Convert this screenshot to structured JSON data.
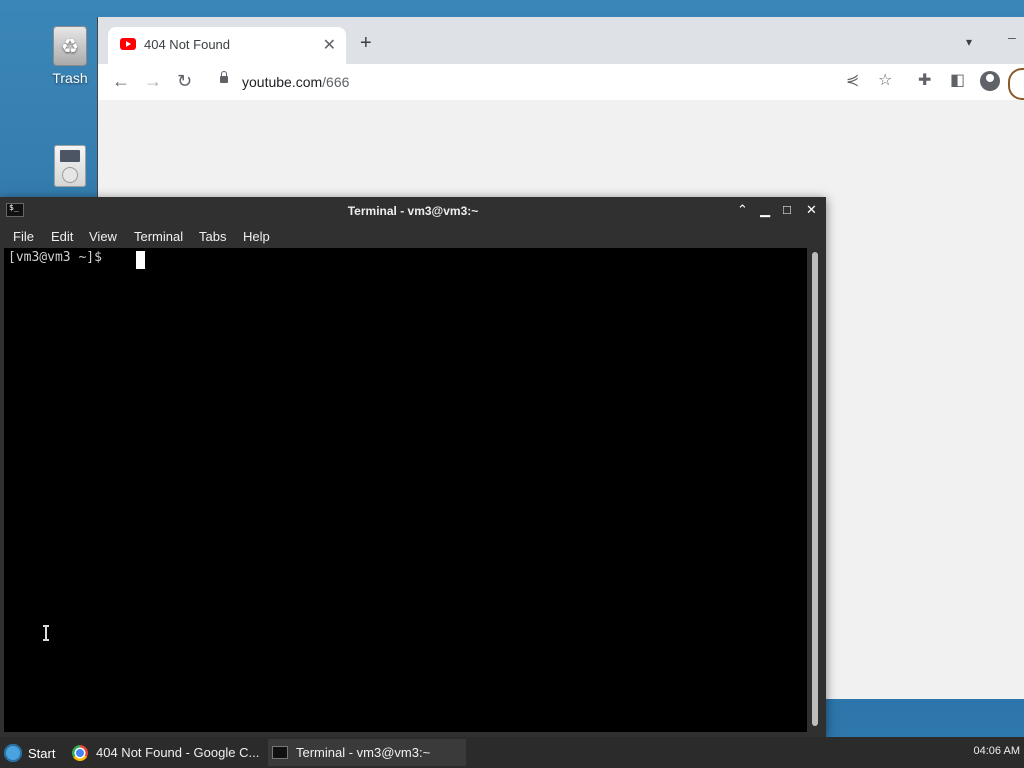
{
  "desktop": {
    "icons": [
      {
        "label": "Trash",
        "icon": "trash-icon"
      },
      {
        "label": "",
        "icon": "file-cabinet-icon"
      }
    ]
  },
  "browser": {
    "tab_title": "404 Not Found",
    "tab_favicon": "youtube-icon",
    "url_host": "youtube.com",
    "url_path": "/666"
  },
  "terminal": {
    "window_title": "Terminal - vm3@vm3:~",
    "menu": [
      "File",
      "Edit",
      "View",
      "Terminal",
      "Tabs",
      "Help"
    ],
    "prompt": "[vm3@vm3 ~]$ "
  },
  "taskbar": {
    "start_label": "Start",
    "tasks": [
      {
        "label": "404 Not Found - Google C...",
        "icon": "chrome-icon"
      },
      {
        "label": "Terminal - vm3@vm3:~",
        "icon": "terminal-icon"
      }
    ],
    "clock": "04:06 AM"
  },
  "colors": {
    "desktop_bg": "#2f76a8",
    "terminal_bg": "#000000",
    "titlebar_bg": "#303030"
  }
}
